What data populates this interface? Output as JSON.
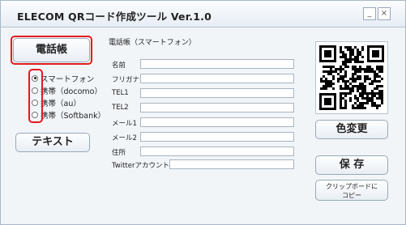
{
  "app": {
    "title": "ELECOM  QRコード作成ツール  Ver.1.0",
    "minimize_label": "_",
    "close_label": "×"
  },
  "sidebar": {
    "phonebook_label": "電話帳",
    "text_label": "テキスト",
    "radio_options": [
      {
        "label": "スマートフォン",
        "checked": true
      },
      {
        "label": "携帯（docomo）",
        "checked": false
      },
      {
        "label": "携帯（au）",
        "checked": false
      },
      {
        "label": "携帯（Softbank）",
        "checked": false
      }
    ]
  },
  "form": {
    "section_title": "電話帳（スマートフォン）",
    "fields": [
      {
        "label": "名前",
        "value": ""
      },
      {
        "label": "フリガナ",
        "value": ""
      },
      {
        "label": "TEL1",
        "value": ""
      },
      {
        "label": "TEL2",
        "value": ""
      },
      {
        "label": "メール1",
        "value": ""
      },
      {
        "label": "メール2",
        "value": ""
      },
      {
        "label": "住所",
        "value": ""
      },
      {
        "label": "Twitterアカウント",
        "value": ""
      }
    ]
  },
  "right": {
    "color_change_label": "色変更",
    "save_label": "保 存",
    "clipboard_label_line1": "クリップボードに",
    "clipboard_label_line2": "コピー"
  },
  "colors": {
    "highlight": "#e31b1b",
    "window_bg": "#f2f5f8",
    "border": "#9aa8b8"
  }
}
